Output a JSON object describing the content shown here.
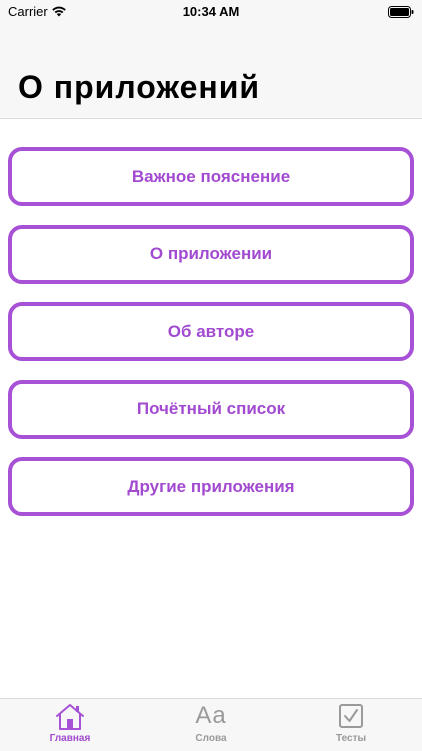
{
  "status_bar": {
    "carrier": "Carrier",
    "time": "10:34 AM",
    "icons": [
      "wifi-icon",
      "battery-icon"
    ]
  },
  "header": {
    "title": "О приложений"
  },
  "menu": {
    "items": [
      {
        "label": "Важное пояснение"
      },
      {
        "label": "О приложении"
      },
      {
        "label": "Об авторе"
      },
      {
        "label": "Почётный список"
      },
      {
        "label": "Другие приложения"
      }
    ]
  },
  "tab_bar": {
    "tabs": [
      {
        "label": "Главная",
        "icon": "home-icon",
        "active": true
      },
      {
        "label": "Слова",
        "icon": "text-size-icon",
        "glyph": "Aa",
        "active": false
      },
      {
        "label": "Тесты",
        "icon": "checkbox-icon",
        "active": false
      }
    ]
  },
  "colors": {
    "accent": "#a752d6",
    "inactive": "#9a9a9a",
    "bar_background": "#f7f7f7"
  }
}
